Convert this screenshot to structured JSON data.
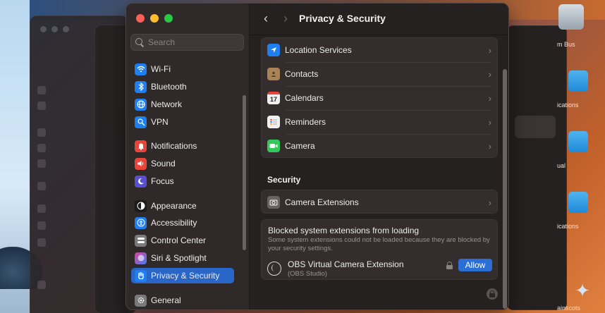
{
  "window": {
    "title": "Privacy & Security"
  },
  "search": {
    "placeholder": "Search"
  },
  "sidebar": {
    "items": [
      {
        "label": "Wi-Fi",
        "icon": "wifi-icon",
        "color": "#1e80f0"
      },
      {
        "label": "Bluetooth",
        "icon": "bluetooth-icon",
        "color": "#1e80f0"
      },
      {
        "label": "Network",
        "icon": "globe-icon",
        "color": "#1e80f0"
      },
      {
        "label": "VPN",
        "icon": "vpn-icon",
        "color": "#1e80f0"
      },
      {
        "label": "Notifications",
        "icon": "bell-icon",
        "color": "#e8443a"
      },
      {
        "label": "Sound",
        "icon": "speaker-icon",
        "color": "#e8443a"
      },
      {
        "label": "Focus",
        "icon": "moon-icon",
        "color": "#5a4fd0"
      },
      {
        "label": "Appearance",
        "icon": "appearance-icon",
        "color": "#1c1c1c"
      },
      {
        "label": "Accessibility",
        "icon": "accessibility-icon",
        "color": "#1e80f0"
      },
      {
        "label": "Control Center",
        "icon": "control-center-icon",
        "color": "#7a7a7a"
      },
      {
        "label": "Siri & Spotlight",
        "icon": "siri-icon",
        "color": "#9a4fd8"
      },
      {
        "label": "Privacy & Security",
        "icon": "hand-icon",
        "color": "#1e80f0",
        "selected": true
      },
      {
        "label": "General",
        "icon": "gear-icon",
        "color": "#7a7a7a"
      }
    ]
  },
  "privacy_rows": [
    {
      "label": "Location Services",
      "icon": "location-arrow-icon",
      "color": "#1e80f0"
    },
    {
      "label": "Contacts",
      "icon": "contacts-icon",
      "color": "#a88458"
    },
    {
      "label": "Calendars",
      "icon": "calendar-icon",
      "color": "#f0f0f0",
      "badge": "17"
    },
    {
      "label": "Reminders",
      "icon": "reminders-icon",
      "color": "#f0f0f0"
    },
    {
      "label": "Camera",
      "icon": "camera-icon",
      "color": "#34c759"
    }
  ],
  "security": {
    "heading": "Security",
    "camera_extensions": {
      "label": "Camera Extensions",
      "icon": "camera-extension-icon"
    },
    "blocked": {
      "title": "Blocked system extensions from loading",
      "description": "Some system extensions could not be loaded because they are blocked by your security settings.",
      "extension_name": "OBS Virtual Camera Extension",
      "extension_source": "(OBS Studio)",
      "allow_label": "Allow"
    }
  },
  "background": {
    "desk_labels": [
      "m Bus",
      "ications",
      "ual",
      "ications",
      "ainscots"
    ]
  }
}
